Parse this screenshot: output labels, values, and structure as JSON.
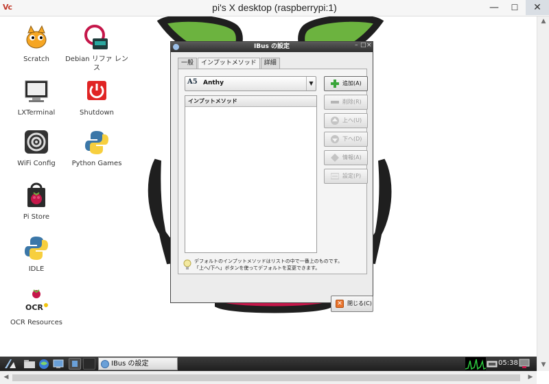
{
  "window": {
    "title": "pi's X desktop (raspberrypi:1)",
    "app_logo_text": "Vc",
    "minimize_glyph": "—",
    "maximize_glyph": "☐",
    "close_glyph": "✕"
  },
  "desktop": {
    "icons": [
      {
        "label": "Scratch"
      },
      {
        "label": "Debian リファ レンス"
      },
      {
        "label": "LXTerminal"
      },
      {
        "label": "Shutdown"
      },
      {
        "label": "WiFi Config"
      },
      {
        "label": "Python Games"
      },
      {
        "label": "Pi Store"
      },
      {
        "label": "IDLE"
      },
      {
        "label": "OCR Resources"
      }
    ]
  },
  "taskbar": {
    "task_label": "IBus の設定",
    "clock": "05:38"
  },
  "dialog": {
    "title": "IBus の設定",
    "tabs": [
      "一般",
      "インプットメソッド",
      "詳細"
    ],
    "active_tab": 1,
    "engine_combo": {
      "value": "Anthy",
      "icon_text": "A5"
    },
    "list_header": "インプットメソッド",
    "buttons": {
      "add": "追加(A)",
      "remove": "削除(R)",
      "up": "上へ(U)",
      "down": "下へ(D)",
      "info": "情報(A)",
      "settings": "設定(P)"
    },
    "hint_line1": "デフォルトのインプットメソッドはリストの中で一番上のものです。",
    "hint_line2": "「上へ/下へ」ボタンを使ってデフォルトを変更できます。",
    "close_button": "閉じる(C)",
    "close_icon_glyph": "✕"
  },
  "colors": {
    "raspberry_red": "#c5174a",
    "leaf_green": "#6cb33f",
    "add_icon": "#3aa53a"
  }
}
